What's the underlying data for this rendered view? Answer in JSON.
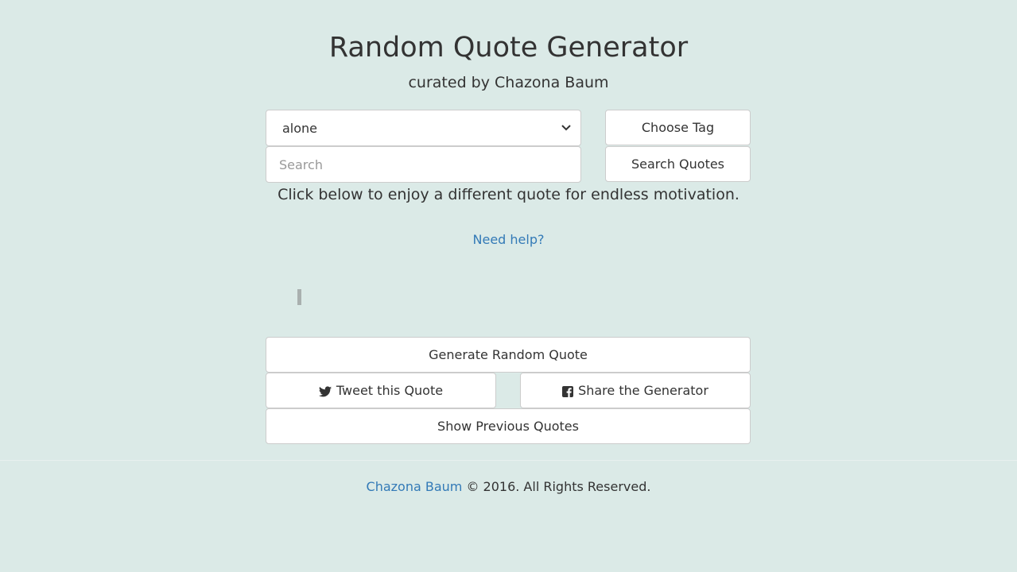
{
  "header": {
    "title": "Random Quote Generator",
    "subtitle": "curated by Chazona Baum"
  },
  "controls": {
    "tag_select_value": "alone",
    "search_placeholder": "Search",
    "choose_tag_label": "Choose Tag",
    "search_quotes_label": "Search Quotes"
  },
  "main": {
    "motivation_text": "Click below to enjoy a different quote for endless motivation.",
    "help_link": "Need help?"
  },
  "actions": {
    "generate_label": "Generate Random Quote",
    "tweet_label": "Tweet this Quote",
    "share_label": "Share the Generator",
    "previous_label": "Show Previous Quotes",
    "tweet_icon": "twitter-icon",
    "share_icon": "facebook-icon"
  },
  "footer": {
    "author": "Chazona Baum",
    "copyright": "© 2016. All Rights Reserved."
  },
  "colors": {
    "background": "#dbeae7",
    "link": "#337ab7",
    "text": "#333333",
    "button_bg": "#ffffff",
    "border": "#cccccc"
  }
}
